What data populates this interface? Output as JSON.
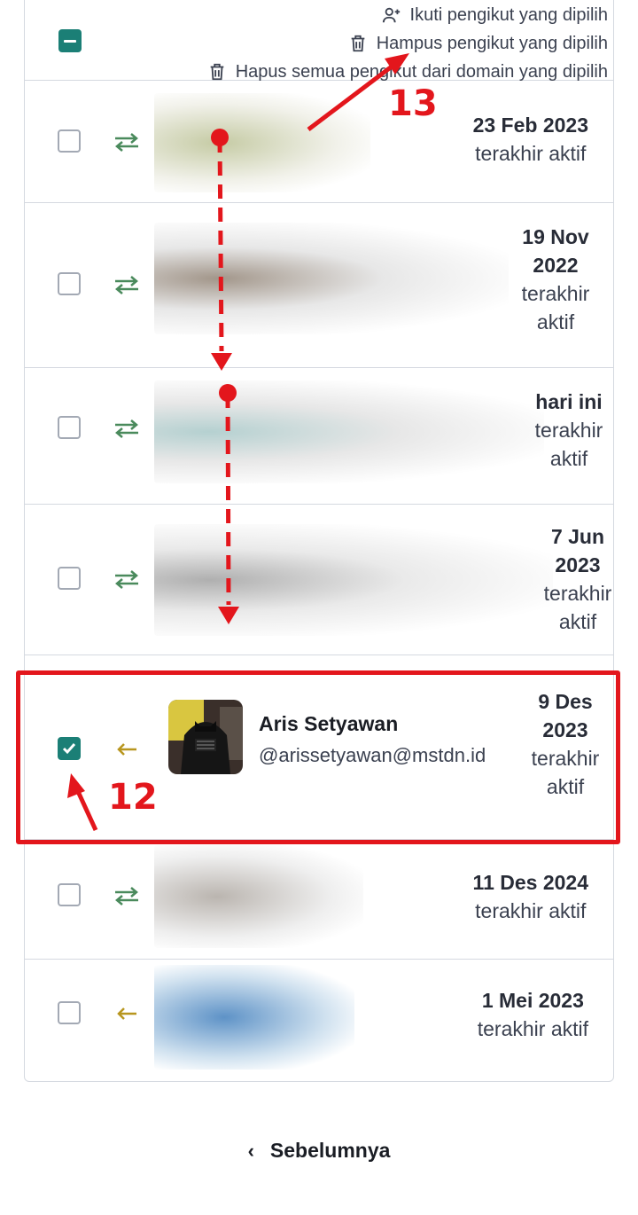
{
  "header": {
    "actions": [
      {
        "label": "Ikuti pengikut yang dipilih",
        "icon": "user-plus-icon"
      },
      {
        "label": "Hampus pengikut yang dipilih",
        "icon": "trash-icon"
      },
      {
        "label": "Hapus semua pengikut dari domain yang dipilih",
        "icon": "trash-icon"
      }
    ]
  },
  "rows": [
    {
      "date": "23 Feb 2023",
      "label": "terakhir aktif",
      "relation": "mutual",
      "checked": false
    },
    {
      "date": "19 Nov 2022",
      "label": "terakhir aktif",
      "relation": "mutual",
      "checked": false
    },
    {
      "date": "hari ini",
      "label": "terakhir aktif",
      "relation": "mutual",
      "checked": false
    },
    {
      "date": "7 Jun 2023",
      "label": "terakhir aktif",
      "relation": "mutual",
      "checked": false
    },
    {
      "date": "9 Des 2023",
      "label": "terakhir aktif",
      "relation": "follower",
      "checked": true,
      "name": "Aris Setyawan",
      "handle": "@arissetyawan@mstdn.id"
    },
    {
      "date": "11 Des 2024",
      "label": "terakhir aktif",
      "relation": "mutual",
      "checked": false
    },
    {
      "date": "1 Mei 2023",
      "label": "terakhir aktif",
      "relation": "follower",
      "checked": false
    }
  ],
  "annotations": {
    "step_12": "12",
    "step_13": "13"
  },
  "pager": {
    "prev_label": "Sebelumnya"
  },
  "colors": {
    "accent": "#1b7f76",
    "mutual": "#4a8a5c",
    "follower": "#b8961f",
    "annotation": "#e3161c"
  }
}
